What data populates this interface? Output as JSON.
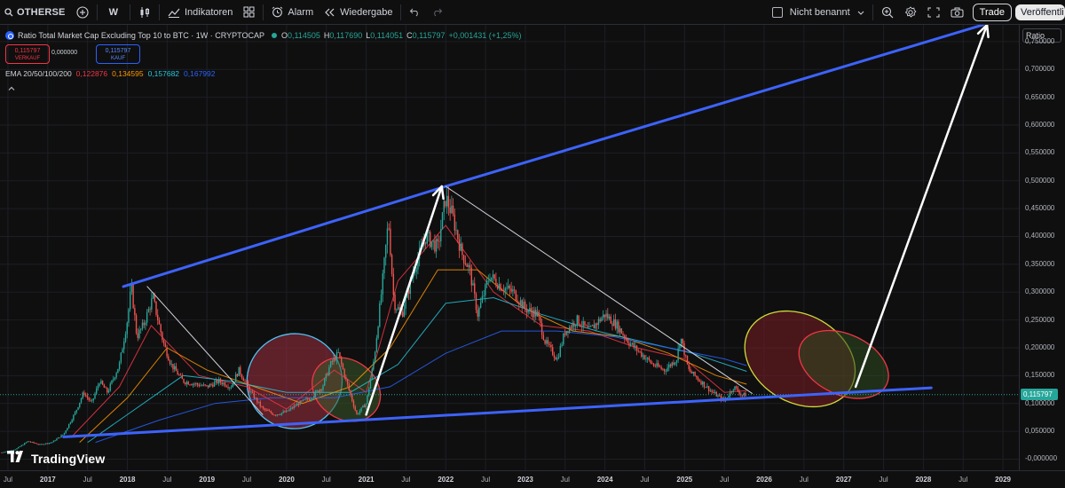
{
  "toolbar": {
    "symbol": "OTHERSE",
    "interval": "W",
    "indicators": "Indikatoren",
    "alert": "Alarm",
    "replay": "Wiedergabe",
    "layout_name": "Nicht benannt",
    "trade": "Trade",
    "publish": "Veröffentli"
  },
  "legend": {
    "title": "Ratio Total Market Cap Excluding Top 10 to BTC · 1W · CRYPTOCAP",
    "o_label": "O",
    "o_value": "0,114505",
    "h_label": "H",
    "h_value": "0,117690",
    "l_label": "L",
    "l_value": "0,114051",
    "c_label": "C",
    "c_value": "0,115797",
    "change": "+0,001431 (+1,25%)",
    "sell_price": "0,115797",
    "sell_label": "VERKAUF",
    "spread": "0,000000",
    "buy_price": "0,115797",
    "buy_label": "KAUF",
    "ema_label": "EMA 20/50/100/200",
    "ema_values": [
      "0,122876",
      "0,134595",
      "0,157682",
      "0,167992"
    ],
    "ema_colors": [
      "#f23645",
      "#ff9800",
      "#26c6da",
      "#2962ff"
    ]
  },
  "price_scale": {
    "unit": "Ratio",
    "last_price": "0,115797"
  },
  "brand": "TradingView",
  "chart_data": {
    "type": "line",
    "title": "Ratio Total Market Cap Excluding Top 10 to BTC · 1W · CRYPTOCAP",
    "ylabel": "Ratio",
    "ylim": [
      -0.02,
      0.78
    ],
    "x_range": [
      2016.4,
      2029.2
    ],
    "grid": true,
    "y_ticks": [
      0,
      0.05,
      0.1,
      0.15,
      0.2,
      0.25,
      0.3,
      0.35,
      0.4,
      0.45,
      0.5,
      0.55,
      0.6,
      0.65,
      0.7,
      0.75
    ],
    "y_tick_labels": [
      "-0,000000",
      "0,050000",
      "0,100000",
      "0,150000",
      "0,200000",
      "0,250000",
      "0,300000",
      "0,350000",
      "0,400000",
      "0,450000",
      "0,500000",
      "0,550000",
      "0,600000",
      "0,650000",
      "0,700000",
      "0,750000"
    ],
    "x_ticks": [
      {
        "t": 2016.5,
        "label": "Jul",
        "year": false
      },
      {
        "t": 2017.0,
        "label": "2017",
        "year": true
      },
      {
        "t": 2017.5,
        "label": "Jul",
        "year": false
      },
      {
        "t": 2018.0,
        "label": "2018",
        "year": true
      },
      {
        "t": 2018.5,
        "label": "Jul",
        "year": false
      },
      {
        "t": 2019.0,
        "label": "2019",
        "year": true
      },
      {
        "t": 2019.5,
        "label": "Jul",
        "year": false
      },
      {
        "t": 2020.0,
        "label": "2020",
        "year": true
      },
      {
        "t": 2020.5,
        "label": "Jul",
        "year": false
      },
      {
        "t": 2021.0,
        "label": "2021",
        "year": true
      },
      {
        "t": 2021.5,
        "label": "Jul",
        "year": false
      },
      {
        "t": 2022.0,
        "label": "2022",
        "year": true
      },
      {
        "t": 2022.5,
        "label": "Jul",
        "year": false
      },
      {
        "t": 2023.0,
        "label": "2023",
        "year": true
      },
      {
        "t": 2023.5,
        "label": "Jul",
        "year": false
      },
      {
        "t": 2024.0,
        "label": "2024",
        "year": true
      },
      {
        "t": 2024.5,
        "label": "Jul",
        "year": false
      },
      {
        "t": 2025.0,
        "label": "2025",
        "year": true
      },
      {
        "t": 2025.5,
        "label": "Jul",
        "year": false
      },
      {
        "t": 2026.0,
        "label": "2026",
        "year": true
      },
      {
        "t": 2026.5,
        "label": "Jul",
        "year": false
      },
      {
        "t": 2027.0,
        "label": "2027",
        "year": true
      },
      {
        "t": 2027.5,
        "label": "Jul",
        "year": false
      },
      {
        "t": 2028.0,
        "label": "2028",
        "year": true
      },
      {
        "t": 2028.5,
        "label": "Jul",
        "year": false
      },
      {
        "t": 2029.0,
        "label": "2029",
        "year": true
      }
    ],
    "price_series": {
      "name": "OTHERSE",
      "points": [
        [
          2016.42,
          0.012
        ],
        [
          2016.6,
          0.018
        ],
        [
          2016.75,
          0.032
        ],
        [
          2016.9,
          0.026
        ],
        [
          2017.05,
          0.03
        ],
        [
          2017.2,
          0.045
        ],
        [
          2017.35,
          0.085
        ],
        [
          2017.45,
          0.12
        ],
        [
          2017.55,
          0.1
        ],
        [
          2017.65,
          0.14
        ],
        [
          2017.75,
          0.12
        ],
        [
          2017.9,
          0.17
        ],
        [
          2018.0,
          0.25
        ],
        [
          2018.05,
          0.31
        ],
        [
          2018.12,
          0.22
        ],
        [
          2018.2,
          0.24
        ],
        [
          2018.32,
          0.29
        ],
        [
          2018.45,
          0.21
        ],
        [
          2018.55,
          0.17
        ],
        [
          2018.7,
          0.14
        ],
        [
          2018.85,
          0.135
        ],
        [
          2019.0,
          0.13
        ],
        [
          2019.15,
          0.14
        ],
        [
          2019.3,
          0.13
        ],
        [
          2019.4,
          0.16
        ],
        [
          2019.55,
          0.12
        ],
        [
          2019.7,
          0.09
        ],
        [
          2019.85,
          0.08
        ],
        [
          2020.0,
          0.085
        ],
        [
          2020.15,
          0.1
        ],
        [
          2020.3,
          0.11
        ],
        [
          2020.45,
          0.13
        ],
        [
          2020.55,
          0.17
        ],
        [
          2020.65,
          0.19
        ],
        [
          2020.75,
          0.14
        ],
        [
          2020.88,
          0.08
        ],
        [
          2021.0,
          0.1
        ],
        [
          2021.1,
          0.18
        ],
        [
          2021.2,
          0.31
        ],
        [
          2021.28,
          0.43
        ],
        [
          2021.35,
          0.28
        ],
        [
          2021.45,
          0.26
        ],
        [
          2021.6,
          0.34
        ],
        [
          2021.75,
          0.4
        ],
        [
          2021.9,
          0.38
        ],
        [
          2022.0,
          0.47
        ],
        [
          2022.08,
          0.44
        ],
        [
          2022.2,
          0.37
        ],
        [
          2022.3,
          0.34
        ],
        [
          2022.4,
          0.26
        ],
        [
          2022.55,
          0.33
        ],
        [
          2022.7,
          0.31
        ],
        [
          2022.85,
          0.3
        ],
        [
          2023.0,
          0.27
        ],
        [
          2023.15,
          0.26
        ],
        [
          2023.25,
          0.21
        ],
        [
          2023.4,
          0.18
        ],
        [
          2023.5,
          0.23
        ],
        [
          2023.65,
          0.25
        ],
        [
          2023.8,
          0.23
        ],
        [
          2024.0,
          0.26
        ],
        [
          2024.15,
          0.24
        ],
        [
          2024.3,
          0.21
        ],
        [
          2024.45,
          0.19
        ],
        [
          2024.6,
          0.17
        ],
        [
          2024.75,
          0.16
        ],
        [
          2024.9,
          0.18
        ],
        [
          2024.95,
          0.22
        ],
        [
          2025.05,
          0.16
        ],
        [
          2025.2,
          0.14
        ],
        [
          2025.35,
          0.12
        ],
        [
          2025.5,
          0.105
        ],
        [
          2025.62,
          0.13
        ],
        [
          2025.72,
          0.115
        ],
        [
          2025.78,
          0.1158
        ]
      ]
    },
    "ema_series": [
      {
        "name": "EMA 20",
        "color": "#f23645",
        "points": [
          [
            2017.3,
            0.04
          ],
          [
            2017.9,
            0.13
          ],
          [
            2018.3,
            0.24
          ],
          [
            2018.9,
            0.15
          ],
          [
            2019.5,
            0.13
          ],
          [
            2020.0,
            0.09
          ],
          [
            2020.6,
            0.16
          ],
          [
            2021.0,
            0.12
          ],
          [
            2021.4,
            0.32
          ],
          [
            2022.0,
            0.42
          ],
          [
            2022.6,
            0.3
          ],
          [
            2023.2,
            0.24
          ],
          [
            2023.8,
            0.23
          ],
          [
            2024.4,
            0.2
          ],
          [
            2025.0,
            0.18
          ],
          [
            2025.5,
            0.12
          ],
          [
            2025.78,
            0.123
          ]
        ]
      },
      {
        "name": "EMA 50",
        "color": "#ff9800",
        "points": [
          [
            2017.4,
            0.03
          ],
          [
            2018.0,
            0.11
          ],
          [
            2018.5,
            0.2
          ],
          [
            2019.0,
            0.16
          ],
          [
            2019.6,
            0.13
          ],
          [
            2020.2,
            0.1
          ],
          [
            2020.8,
            0.13
          ],
          [
            2021.3,
            0.2
          ],
          [
            2021.9,
            0.34
          ],
          [
            2022.4,
            0.34
          ],
          [
            2023.0,
            0.27
          ],
          [
            2023.6,
            0.23
          ],
          [
            2024.2,
            0.22
          ],
          [
            2024.8,
            0.19
          ],
          [
            2025.4,
            0.15
          ],
          [
            2025.78,
            0.1346
          ]
        ]
      },
      {
        "name": "EMA 100",
        "color": "#26c6da",
        "points": [
          [
            2017.5,
            0.03
          ],
          [
            2018.1,
            0.09
          ],
          [
            2018.7,
            0.15
          ],
          [
            2019.3,
            0.14
          ],
          [
            2020.0,
            0.12
          ],
          [
            2020.8,
            0.12
          ],
          [
            2021.4,
            0.17
          ],
          [
            2022.0,
            0.28
          ],
          [
            2022.6,
            0.29
          ],
          [
            2023.2,
            0.26
          ],
          [
            2023.9,
            0.23
          ],
          [
            2024.5,
            0.21
          ],
          [
            2025.1,
            0.19
          ],
          [
            2025.78,
            0.1577
          ]
        ]
      },
      {
        "name": "EMA 200",
        "color": "#2962ff",
        "points": [
          [
            2017.6,
            0.03
          ],
          [
            2018.4,
            0.07
          ],
          [
            2019.1,
            0.1
          ],
          [
            2019.8,
            0.11
          ],
          [
            2020.6,
            0.11
          ],
          [
            2021.3,
            0.13
          ],
          [
            2022.0,
            0.19
          ],
          [
            2022.7,
            0.23
          ],
          [
            2023.4,
            0.23
          ],
          [
            2024.1,
            0.22
          ],
          [
            2024.8,
            0.2
          ],
          [
            2025.5,
            0.18
          ],
          [
            2025.78,
            0.168
          ]
        ]
      }
    ],
    "drawings": [
      {
        "kind": "trendline",
        "color": "#3d63ff",
        "points": [
          [
            2017.95,
            0.31
          ],
          [
            2022.0,
            0.49
          ],
          [
            2028.75,
            0.78
          ]
        ]
      },
      {
        "kind": "trendline",
        "color": "#3d63ff",
        "points": [
          [
            2017.2,
            0.04
          ],
          [
            2028.1,
            0.128
          ]
        ]
      },
      {
        "kind": "trendline",
        "color": "#d1d4dc",
        "points": [
          [
            2018.25,
            0.31
          ],
          [
            2019.7,
            0.08
          ]
        ]
      },
      {
        "kind": "trendline",
        "color": "#d1d4dc",
        "points": [
          [
            2022.0,
            0.49
          ],
          [
            2025.85,
            0.118
          ]
        ]
      },
      {
        "kind": "arrow",
        "color": "#ffffff",
        "points": [
          [
            2021.0,
            0.08
          ],
          [
            2021.95,
            0.49
          ]
        ]
      },
      {
        "kind": "arrow",
        "color": "#ffffff",
        "points": [
          [
            2027.15,
            0.13
          ],
          [
            2028.8,
            0.78
          ]
        ]
      }
    ],
    "ellipses": [
      {
        "cx": 2020.1,
        "cy": 0.14,
        "rx": 0.6,
        "ry": 0.085,
        "angle": -40,
        "fill": "#a03040",
        "stroke": "#4fc3f7"
      },
      {
        "cx": 2020.75,
        "cy": 0.125,
        "rx": 0.37,
        "ry": 0.065,
        "angle": -55,
        "fill": "#3a5a2a",
        "stroke": "#f23645"
      },
      {
        "cx": 2026.45,
        "cy": 0.18,
        "rx": 0.55,
        "ry": 0.105,
        "angle": -60,
        "fill": "#7a1e24",
        "stroke": "#cddc39"
      },
      {
        "cx": 2027.0,
        "cy": 0.17,
        "rx": 0.38,
        "ry": 0.085,
        "angle": -65,
        "fill": "#2f4a20",
        "stroke": "#f23645"
      }
    ],
    "last_price": 0.115797
  }
}
